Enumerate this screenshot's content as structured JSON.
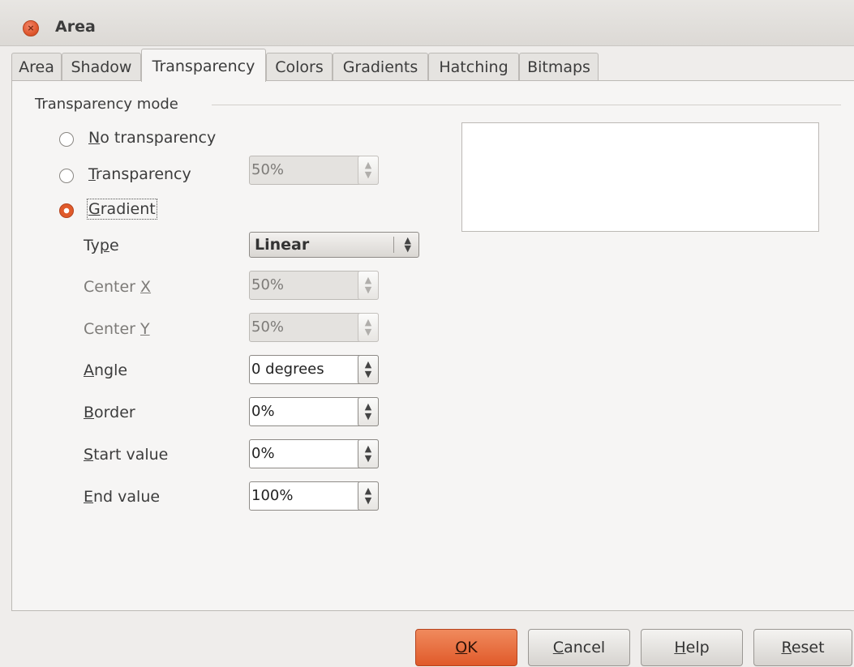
{
  "window": {
    "title": "Area"
  },
  "tabs": [
    "Area",
    "Shadow",
    "Transparency",
    "Colors",
    "Gradients",
    "Hatching",
    "Bitmaps"
  ],
  "active_tab": "Transparency",
  "section": {
    "label": "Transparency mode"
  },
  "radios": {
    "no_transparency": {
      "label": "No transparency",
      "mnemonic": "N",
      "rest": "o transparency",
      "selected": false
    },
    "transparency": {
      "label": "Transparency",
      "mnemonic": "T",
      "rest": "ransparency",
      "selected": false,
      "value": "50%"
    },
    "gradient": {
      "label": "Gradient",
      "mnemonic": "G",
      "rest": "radient",
      "selected": true
    }
  },
  "fields": {
    "type": {
      "label_pre": "Ty",
      "mnemonic": "p",
      "label_post": "e",
      "value": "Linear"
    },
    "center_x": {
      "label_pre": "Center ",
      "mnemonic": "X",
      "value": "50%",
      "disabled": true
    },
    "center_y": {
      "label_pre": "Center ",
      "mnemonic": "Y",
      "value": "50%",
      "disabled": true
    },
    "angle": {
      "mnemonic": "A",
      "label_post": "ngle",
      "value": "0 degrees"
    },
    "border": {
      "mnemonic": "B",
      "label_post": "order",
      "value": "0%"
    },
    "start_value": {
      "mnemonic": "S",
      "label_post": "tart value",
      "value": "0%"
    },
    "end_value": {
      "mnemonic": "E",
      "label_post": "nd value",
      "value": "100%"
    }
  },
  "buttons": {
    "ok": {
      "mnemonic": "O",
      "rest": "K"
    },
    "cancel": {
      "mnemonic": "C",
      "rest": "ancel"
    },
    "help": {
      "mnemonic": "H",
      "rest": "elp"
    },
    "reset": {
      "mnemonic": "R",
      "rest": "eset"
    }
  },
  "colors": {
    "accent": "#e05a2a",
    "background": "#efedeb",
    "panel": "#f6f5f4"
  },
  "icons": {
    "close": "close-icon",
    "spin": "spin-arrows-icon",
    "select": "select-arrows-icon"
  }
}
